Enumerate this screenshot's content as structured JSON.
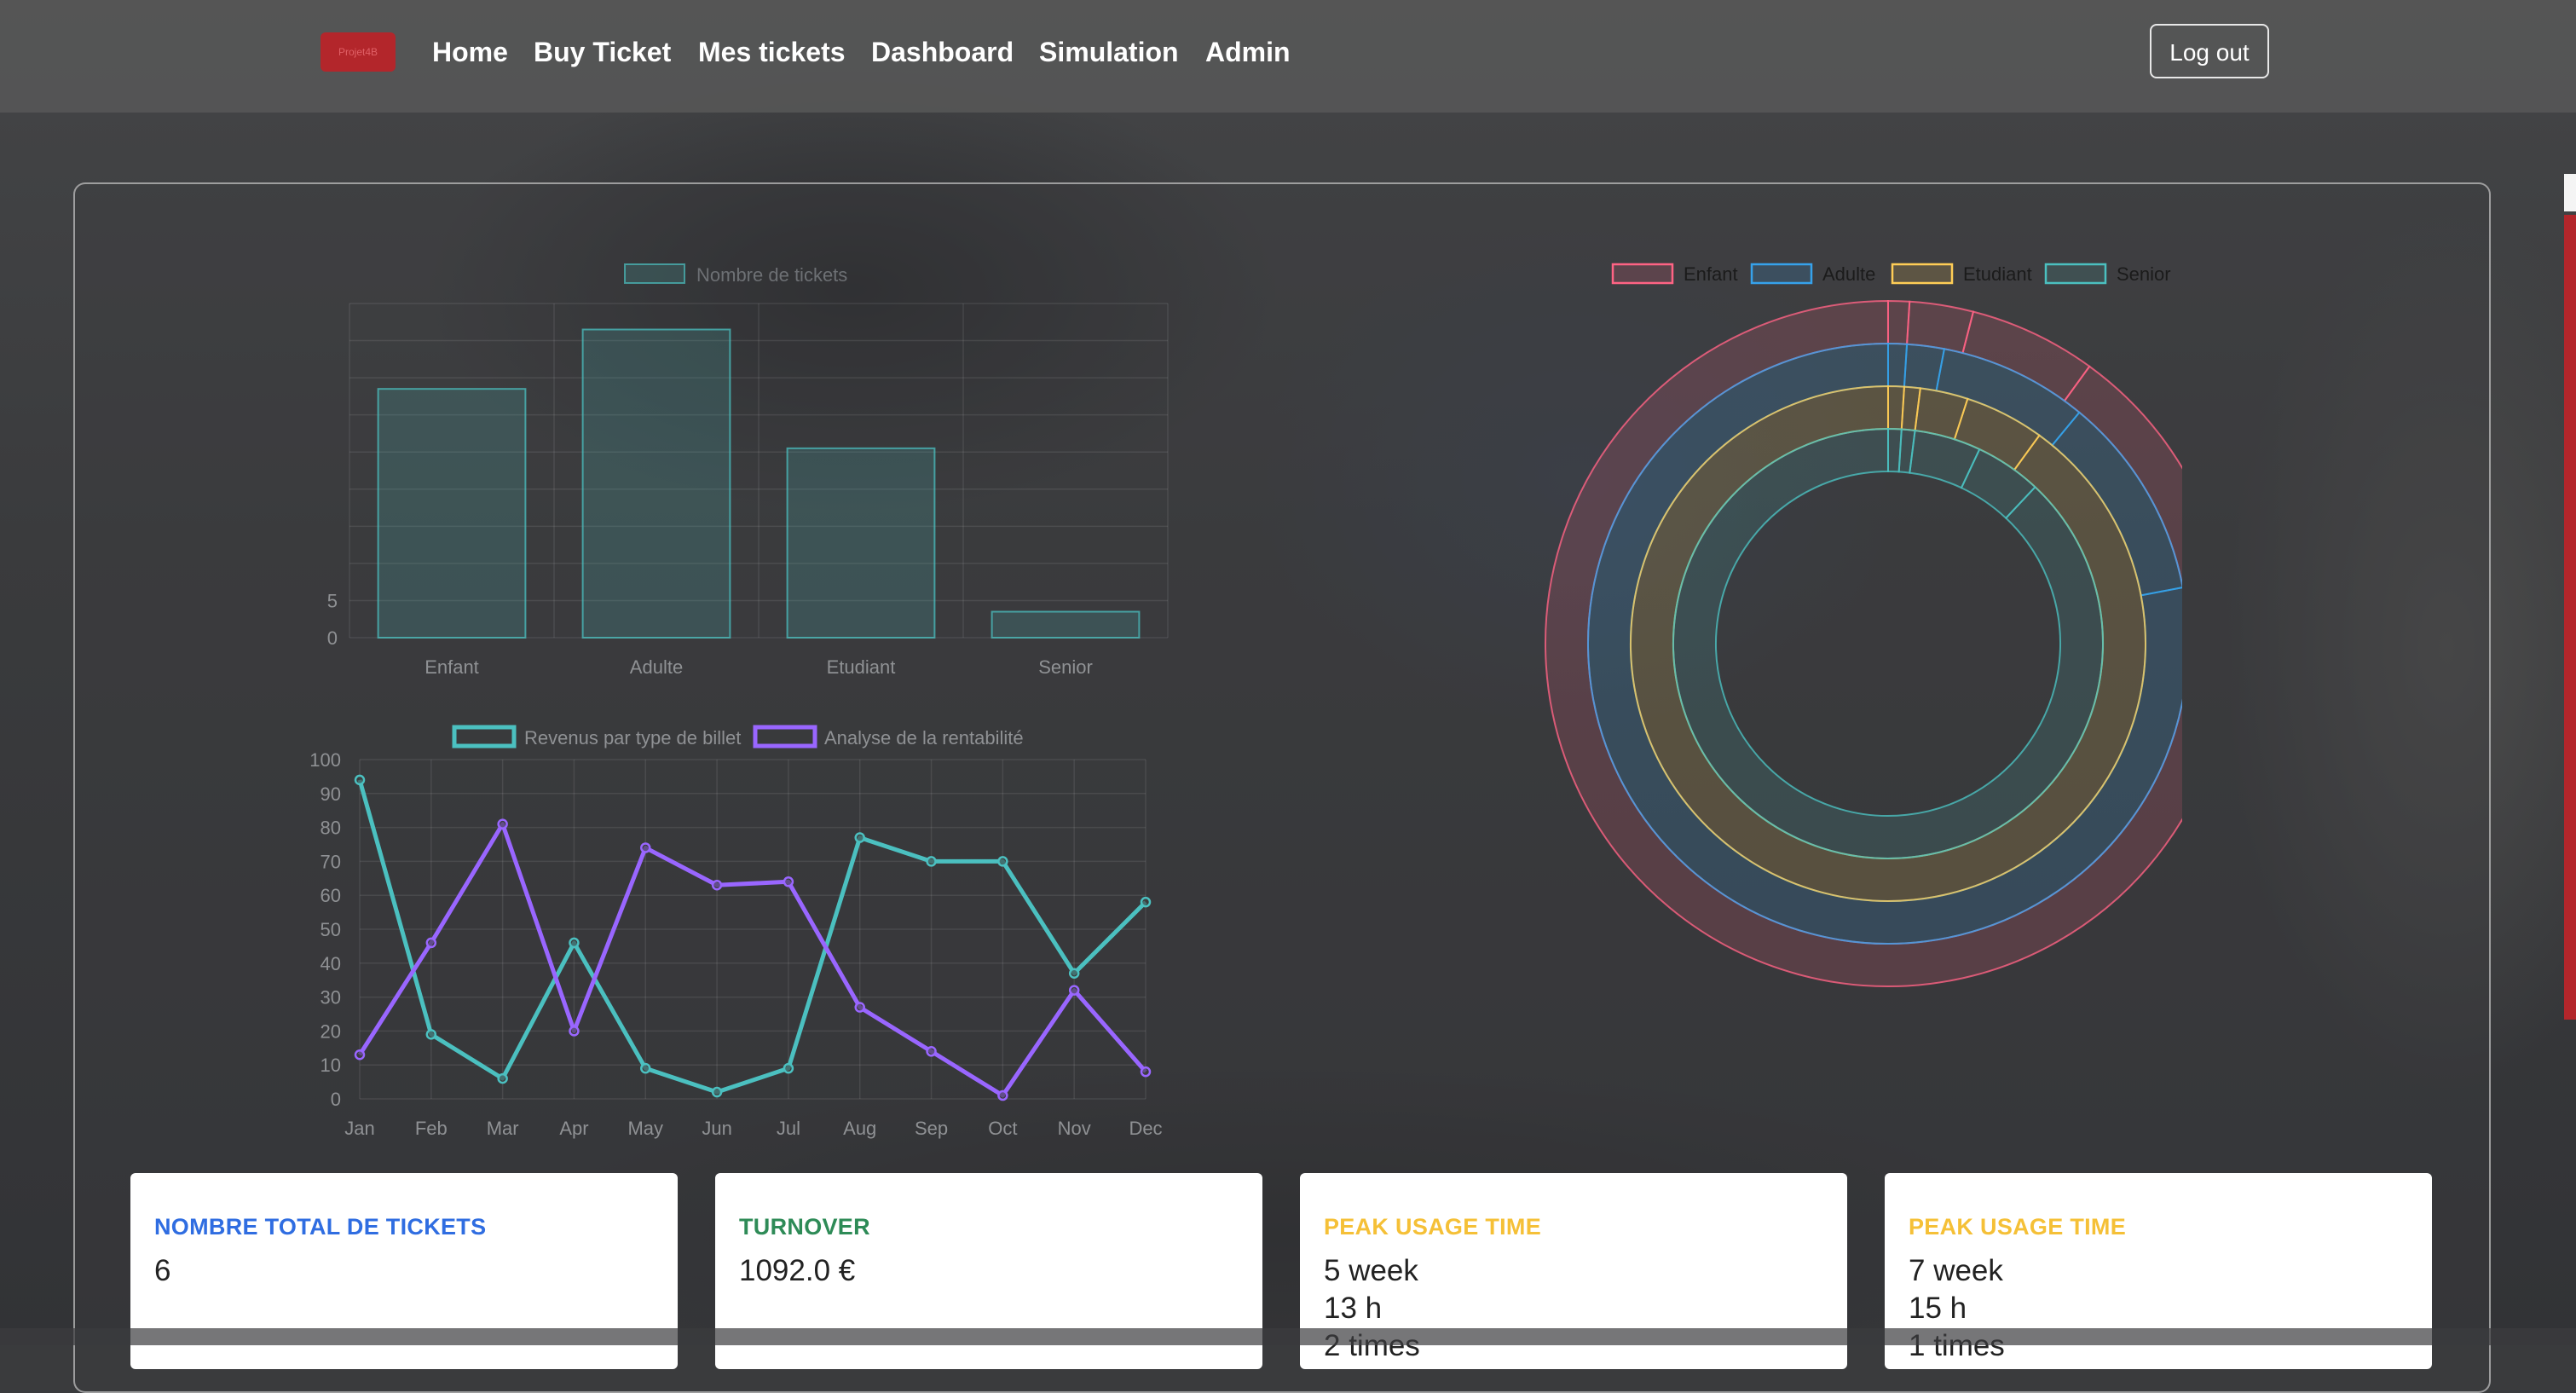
{
  "nav": {
    "brand": "Projet4B",
    "links": [
      "Home",
      "Buy Ticket",
      "Mes tickets",
      "Dashboard",
      "Simulation",
      "Admin"
    ],
    "logout": "Log out"
  },
  "colors": {
    "teal": "#4bc0c0",
    "purple": "#9966ff",
    "red": "#ff6384",
    "blue": "#36a2eb",
    "yellow": "#ffcd56",
    "brand": "#b3262b"
  },
  "chart_data": [
    {
      "type": "bar",
      "legend": [
        "Nombre de tickets"
      ],
      "categories": [
        "Enfant",
        "Adulte",
        "Etudiant",
        "Senior"
      ],
      "values": [
        33.5,
        41.5,
        25.5,
        3.5
      ],
      "yticks": [
        "0",
        "5"
      ],
      "ylim": [
        0,
        45
      ],
      "grid": true
    },
    {
      "type": "line",
      "x": [
        "Jan",
        "Feb",
        "Mar",
        "Apr",
        "May",
        "Jun",
        "Jul",
        "Aug",
        "Sep",
        "Oct",
        "Nov",
        "Dec"
      ],
      "series": [
        {
          "name": "Revenus par type de billet",
          "values": [
            94,
            19,
            6,
            46,
            9,
            2,
            9,
            77,
            70,
            70,
            37,
            58
          ]
        },
        {
          "name": "Analyse de la rentabilité",
          "values": [
            13,
            46,
            81,
            20,
            74,
            63,
            64,
            27,
            14,
            1,
            32,
            8
          ]
        }
      ],
      "yticks": [
        "0",
        "10",
        "20",
        "30",
        "40",
        "50",
        "60",
        "70",
        "80",
        "90",
        "100"
      ],
      "ylim": [
        0,
        100
      ],
      "grid": true,
      "legend_position": "top"
    },
    {
      "type": "pie",
      "legend": [
        "Enfant",
        "Adulte",
        "Etudiant",
        "Senior"
      ],
      "legend_position": "top",
      "rings": [
        [
          1,
          3,
          6,
          12,
          78
        ],
        [
          1,
          2,
          8,
          11,
          78
        ],
        [
          1,
          1,
          3,
          5,
          90
        ],
        [
          1,
          1,
          5,
          5,
          88
        ]
      ]
    }
  ],
  "cards": [
    {
      "title": "NOMBRE TOTAL DE TICKETS",
      "color": "#2f6de1",
      "lines": [
        "6"
      ]
    },
    {
      "title": "TURNOVER",
      "color": "#2e8b57",
      "lines": [
        "1092.0 €"
      ]
    },
    {
      "title": "PEAK USAGE TIME",
      "color": "#f5c037",
      "lines": [
        "5 week",
        "13 h",
        "2 times"
      ]
    },
    {
      "title": "PEAK USAGE TIME",
      "color": "#f5c037",
      "lines": [
        "7 week",
        "15 h",
        "1 times"
      ]
    }
  ]
}
